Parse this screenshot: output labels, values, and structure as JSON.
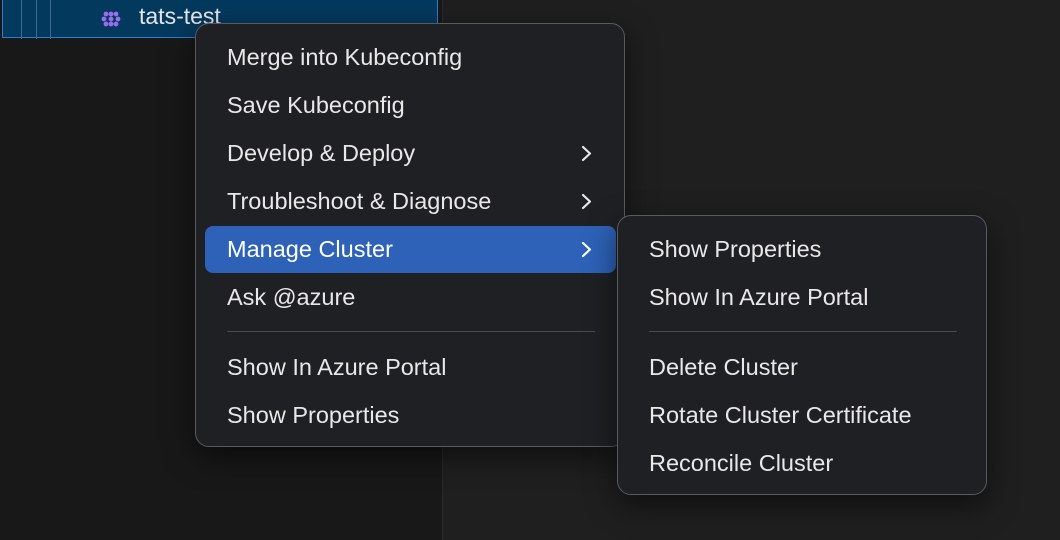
{
  "tree": {
    "selected_item_label": "tats-test",
    "selected_item_icon": "kubernetes-cluster-icon",
    "accent_color": "#9b6cf0"
  },
  "context_menu": {
    "items": [
      {
        "label": "Merge into Kubeconfig"
      },
      {
        "label": "Save Kubeconfig"
      },
      {
        "label": "Develop & Deploy",
        "has_submenu": true
      },
      {
        "label": "Troubleshoot & Diagnose",
        "has_submenu": true
      },
      {
        "label": "Manage Cluster",
        "has_submenu": true,
        "highlighted": true
      },
      {
        "label": "Ask @azure"
      },
      {
        "label": "Show In Azure Portal"
      },
      {
        "label": "Show Properties"
      }
    ]
  },
  "submenu": {
    "parent": "Manage Cluster",
    "items": [
      {
        "label": "Show Properties"
      },
      {
        "label": "Show In Azure Portal"
      },
      {
        "label": "Delete Cluster"
      },
      {
        "label": "Rotate Cluster Certificate"
      },
      {
        "label": "Reconcile Cluster"
      }
    ]
  },
  "colors": {
    "highlight": "#2d62b8",
    "menu_background": "#1f2023"
  }
}
